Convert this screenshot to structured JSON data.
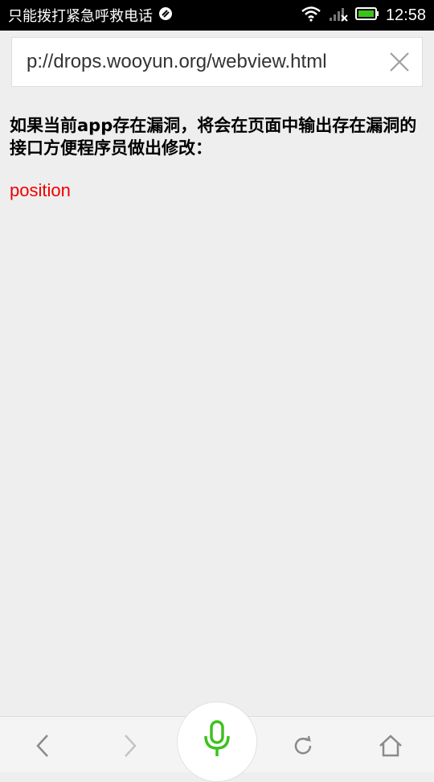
{
  "status_bar": {
    "carrier_text": "只能拨打紧急呼救电话",
    "time": "12:58",
    "icons": [
      "satellite-icon",
      "wifi-icon",
      "signal-off-icon",
      "battery-charging-icon"
    ]
  },
  "url_bar": {
    "url": "p://drops.wooyun.org/webview.html",
    "clear_icon": "close-icon"
  },
  "page": {
    "message": "如果当前app存在漏洞，将会在页面中输出存在漏洞的接口方便程序员做出修改：",
    "result": "position"
  },
  "bottom_nav": {
    "back_icon": "chevron-left-icon",
    "forward_icon": "chevron-right-icon",
    "voice_icon": "microphone-icon",
    "refresh_icon": "refresh-icon",
    "home_icon": "home-icon"
  },
  "colors": {
    "accent_green": "#3cc21c",
    "result_red": "#ee0000"
  }
}
